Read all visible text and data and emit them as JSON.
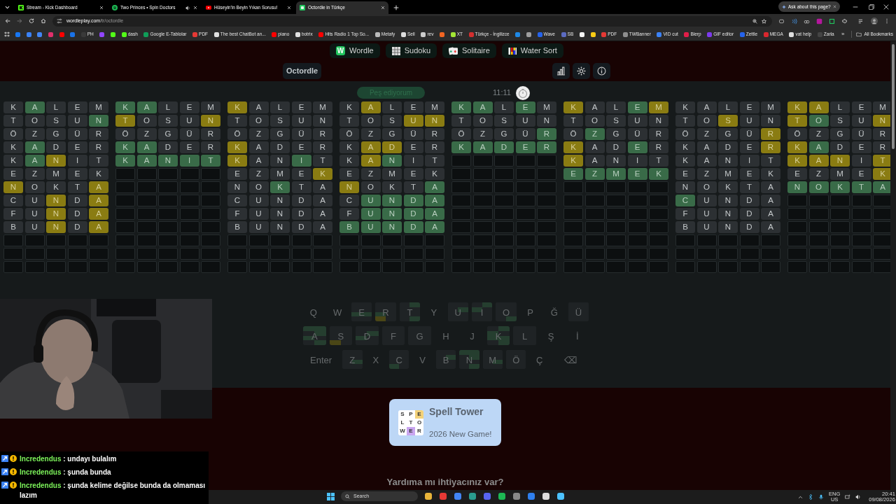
{
  "browser": {
    "tabs": [
      {
        "title": "Stream - Kick Dashboard",
        "kind": "kick",
        "audio": false,
        "selected": false
      },
      {
        "title": "Two Princes • Spin Doctors",
        "kind": "spotify",
        "audio": true,
        "selected": false
      },
      {
        "title": "Hüseyin'in Beyin Yıkan Sorusu!",
        "kind": "youtube",
        "audio": false,
        "selected": false
      },
      {
        "title": "Octordle in Türkçe",
        "kind": "wordle",
        "audio": false,
        "selected": true
      }
    ],
    "ask_button": "Ask about this page?",
    "url_host": "wordleplay.com",
    "url_path": "/tr/octordle",
    "bookmarks": [
      {
        "color": "#1877f2"
      },
      {
        "color": "#3b82f6"
      },
      {
        "color": "#4285f4"
      },
      {
        "color": "#e1306c"
      },
      {
        "color": "#ff0000"
      },
      {
        "color": "#1a73e8"
      },
      {
        "label": "PH",
        "color": "#3a3a3a"
      },
      {
        "color": "#9146ff"
      },
      {
        "color": "#53fc18"
      },
      {
        "label": "dash",
        "color": "#53fc18"
      },
      {
        "label": "Google E-Tablolar",
        "color": "#0f9d58"
      },
      {
        "label": "PDF",
        "color": "#e53935"
      },
      {
        "label": "The best ChatBot an...",
        "color": "#e0e0e0"
      },
      {
        "label": "piano",
        "color": "#ff0000"
      },
      {
        "label": "botrix",
        "color": "#e0e0e0"
      },
      {
        "label": "Hits Radio 1 Top So...",
        "color": "#ff0000"
      },
      {
        "label": "Metafy",
        "color": "#bbbbbb"
      },
      {
        "label": "Sell",
        "color": "#dddddd"
      },
      {
        "label": "rev",
        "color": "#cccccc"
      },
      {
        "color": "#f26522"
      },
      {
        "label": "XT",
        "color": "#a3e635"
      },
      {
        "label": "Türkçe - İngilizce",
        "color": "#d32f2f"
      },
      {
        "color": "#1e88e5"
      },
      {
        "color": "#9e9e9e"
      },
      {
        "label": "Wave",
        "color": "#2563eb"
      },
      {
        "label": "SB",
        "color": "#5c6bc0"
      },
      {
        "color": "#f5f5f5"
      },
      {
        "color": "#facc15"
      },
      {
        "label": "PDF",
        "color": "#e53935"
      },
      {
        "label": "TWBanner",
        "color": "#8e8e8e"
      },
      {
        "label": "VID cut",
        "color": "#3b82f6"
      },
      {
        "label": "Blerp",
        "color": "#e11d48"
      },
      {
        "label": "GIF editor",
        "color": "#7c3aed"
      },
      {
        "label": "Zettle",
        "color": "#2563eb"
      },
      {
        "label": "MEGA",
        "color": "#d9272e"
      },
      {
        "label": "vat help",
        "color": "#dddddd"
      },
      {
        "label": "Zarla",
        "color": "#444444"
      }
    ],
    "more_bookmarks": "»",
    "all_bookmarks": "All Bookmarks"
  },
  "site": {
    "nav": [
      {
        "label": "Wordle",
        "kind": "wordle",
        "icon_text": "W"
      },
      {
        "label": "Sudoku",
        "kind": "sudoku"
      },
      {
        "label": "Solitaire",
        "kind": "solitaire"
      },
      {
        "label": "Water Sort",
        "kind": "watersort"
      }
    ],
    "game_button": "Octordle",
    "give_up": "Peş ediyorum",
    "timer": "11:11",
    "boards": [
      {
        "rows": [
          {
            "tiles": [
              {
                "letter": "K",
                "kind": "absent"
              },
              {
                "letter": "A",
                "kind": "correct"
              },
              {
                "letter": "L",
                "kind": "absent"
              },
              {
                "letter": "E",
                "kind": "absent"
              },
              {
                "letter": "M",
                "kind": "absent"
              }
            ]
          },
          {
            "tiles": [
              {
                "letter": "T",
                "kind": "absent"
              },
              {
                "letter": "O",
                "kind": "absent"
              },
              {
                "letter": "S",
                "kind": "absent"
              },
              {
                "letter": "U",
                "kind": "absent"
              },
              {
                "letter": "N",
                "kind": "correct"
              }
            ]
          },
          {
            "tiles": [
              {
                "letter": "Ö",
                "kind": "absent"
              },
              {
                "letter": "Z",
                "kind": "absent"
              },
              {
                "letter": "G",
                "kind": "absent"
              },
              {
                "letter": "Ü",
                "kind": "absent"
              },
              {
                "letter": "R",
                "kind": "absent"
              }
            ]
          },
          {
            "tiles": [
              {
                "letter": "K",
                "kind": "absent"
              },
              {
                "letter": "A",
                "kind": "correct"
              },
              {
                "letter": "D",
                "kind": "absent"
              },
              {
                "letter": "E",
                "kind": "absent"
              },
              {
                "letter": "R",
                "kind": "absent"
              }
            ]
          },
          {
            "tiles": [
              {
                "letter": "K",
                "kind": "absent"
              },
              {
                "letter": "A",
                "kind": "correct"
              },
              {
                "letter": "N",
                "kind": "present"
              },
              {
                "letter": "I",
                "kind": "absent"
              },
              {
                "letter": "T",
                "kind": "absent"
              }
            ]
          },
          {
            "tiles": [
              {
                "letter": "E",
                "kind": "absent"
              },
              {
                "letter": "Z",
                "kind": "absent"
              },
              {
                "letter": "M",
                "kind": "absent"
              },
              {
                "letter": "E",
                "kind": "absent"
              },
              {
                "letter": "K",
                "kind": "absent"
              }
            ]
          },
          {
            "tiles": [
              {
                "letter": "N",
                "kind": "present"
              },
              {
                "letter": "O",
                "kind": "absent"
              },
              {
                "letter": "K",
                "kind": "absent"
              },
              {
                "letter": "T",
                "kind": "absent"
              },
              {
                "letter": "A",
                "kind": "present"
              }
            ]
          },
          {
            "tiles": [
              {
                "letter": "C",
                "kind": "absent"
              },
              {
                "letter": "U",
                "kind": "absent"
              },
              {
                "letter": "N",
                "kind": "present"
              },
              {
                "letter": "D",
                "kind": "absent"
              },
              {
                "letter": "A",
                "kind": "present"
              }
            ]
          },
          {
            "tiles": [
              {
                "letter": "F",
                "kind": "absent"
              },
              {
                "letter": "U",
                "kind": "absent"
              },
              {
                "letter": "N",
                "kind": "present"
              },
              {
                "letter": "D",
                "kind": "absent"
              },
              {
                "letter": "A",
                "kind": "present"
              }
            ]
          },
          {
            "tiles": [
              {
                "letter": "B",
                "kind": "absent"
              },
              {
                "letter": "U",
                "kind": "absent"
              },
              {
                "letter": "N",
                "kind": "present"
              },
              {
                "letter": "D",
                "kind": "absent"
              },
              {
                "letter": "A",
                "kind": "present"
              }
            ]
          }
        ]
      },
      {
        "rows": [
          {
            "tiles": [
              {
                "letter": "K",
                "kind": "correct"
              },
              {
                "letter": "A",
                "kind": "correct"
              },
              {
                "letter": "L",
                "kind": "absent"
              },
              {
                "letter": "E",
                "kind": "absent"
              },
              {
                "letter": "M",
                "kind": "absent"
              }
            ]
          },
          {
            "tiles": [
              {
                "letter": "T",
                "kind": "present"
              },
              {
                "letter": "O",
                "kind": "absent"
              },
              {
                "letter": "S",
                "kind": "absent"
              },
              {
                "letter": "U",
                "kind": "absent"
              },
              {
                "letter": "N",
                "kind": "present"
              }
            ]
          },
          {
            "tiles": [
              {
                "letter": "Ö",
                "kind": "absent"
              },
              {
                "letter": "Z",
                "kind": "absent"
              },
              {
                "letter": "G",
                "kind": "absent"
              },
              {
                "letter": "Ü",
                "kind": "absent"
              },
              {
                "letter": "R",
                "kind": "absent"
              }
            ]
          },
          {
            "tiles": [
              {
                "letter": "K",
                "kind": "correct"
              },
              {
                "letter": "A",
                "kind": "correct"
              },
              {
                "letter": "D",
                "kind": "absent"
              },
              {
                "letter": "E",
                "kind": "absent"
              },
              {
                "letter": "R",
                "kind": "absent"
              }
            ]
          },
          {
            "tiles": [
              {
                "letter": "K",
                "kind": "correct"
              },
              {
                "letter": "A",
                "kind": "correct"
              },
              {
                "letter": "N",
                "kind": "correct"
              },
              {
                "letter": "I",
                "kind": "correct"
              },
              {
                "letter": "T",
                "kind": "correct"
              }
            ]
          }
        ]
      },
      {
        "rows": [
          {
            "tiles": [
              {
                "letter": "K",
                "kind": "present"
              },
              {
                "letter": "A",
                "kind": "absent"
              },
              {
                "letter": "L",
                "kind": "absent"
              },
              {
                "letter": "E",
                "kind": "absent"
              },
              {
                "letter": "M",
                "kind": "absent"
              }
            ]
          },
          {
            "tiles": [
              {
                "letter": "T",
                "kind": "absent"
              },
              {
                "letter": "O",
                "kind": "absent"
              },
              {
                "letter": "S",
                "kind": "absent"
              },
              {
                "letter": "U",
                "kind": "absent"
              },
              {
                "letter": "N",
                "kind": "absent"
              }
            ]
          },
          {
            "tiles": [
              {
                "letter": "Ö",
                "kind": "absent"
              },
              {
                "letter": "Z",
                "kind": "absent"
              },
              {
                "letter": "G",
                "kind": "absent"
              },
              {
                "letter": "Ü",
                "kind": "absent"
              },
              {
                "letter": "R",
                "kind": "absent"
              }
            ]
          },
          {
            "tiles": [
              {
                "letter": "K",
                "kind": "present"
              },
              {
                "letter": "A",
                "kind": "absent"
              },
              {
                "letter": "D",
                "kind": "absent"
              },
              {
                "letter": "E",
                "kind": "absent"
              },
              {
                "letter": "R",
                "kind": "absent"
              }
            ]
          },
          {
            "tiles": [
              {
                "letter": "K",
                "kind": "present"
              },
              {
                "letter": "A",
                "kind": "absent"
              },
              {
                "letter": "N",
                "kind": "absent"
              },
              {
                "letter": "I",
                "kind": "correct"
              },
              {
                "letter": "T",
                "kind": "absent"
              }
            ]
          },
          {
            "tiles": [
              {
                "letter": "E",
                "kind": "absent"
              },
              {
                "letter": "Z",
                "kind": "absent"
              },
              {
                "letter": "M",
                "kind": "absent"
              },
              {
                "letter": "E",
                "kind": "absent"
              },
              {
                "letter": "K",
                "kind": "present"
              }
            ]
          },
          {
            "tiles": [
              {
                "letter": "N",
                "kind": "absent"
              },
              {
                "letter": "O",
                "kind": "absent"
              },
              {
                "letter": "K",
                "kind": "correct"
              },
              {
                "letter": "T",
                "kind": "absent"
              },
              {
                "letter": "A",
                "kind": "absent"
              }
            ]
          },
          {
            "tiles": [
              {
                "letter": "C",
                "kind": "absent"
              },
              {
                "letter": "U",
                "kind": "absent"
              },
              {
                "letter": "N",
                "kind": "absent"
              },
              {
                "letter": "D",
                "kind": "absent"
              },
              {
                "letter": "A",
                "kind": "absent"
              }
            ]
          },
          {
            "tiles": [
              {
                "letter": "F",
                "kind": "absent"
              },
              {
                "letter": "U",
                "kind": "absent"
              },
              {
                "letter": "N",
                "kind": "absent"
              },
              {
                "letter": "D",
                "kind": "absent"
              },
              {
                "letter": "A",
                "kind": "absent"
              }
            ]
          },
          {
            "tiles": [
              {
                "letter": "B",
                "kind": "absent"
              },
              {
                "letter": "U",
                "kind": "absent"
              },
              {
                "letter": "N",
                "kind": "absent"
              },
              {
                "letter": "D",
                "kind": "absent"
              },
              {
                "letter": "A",
                "kind": "absent"
              }
            ]
          }
        ]
      },
      {
        "rows": [
          {
            "tiles": [
              {
                "letter": "K",
                "kind": "absent"
              },
              {
                "letter": "A",
                "kind": "present"
              },
              {
                "letter": "L",
                "kind": "absent"
              },
              {
                "letter": "E",
                "kind": "absent"
              },
              {
                "letter": "M",
                "kind": "absent"
              }
            ]
          },
          {
            "tiles": [
              {
                "letter": "T",
                "kind": "absent"
              },
              {
                "letter": "O",
                "kind": "absent"
              },
              {
                "letter": "S",
                "kind": "absent"
              },
              {
                "letter": "U",
                "kind": "present"
              },
              {
                "letter": "N",
                "kind": "present"
              }
            ]
          },
          {
            "tiles": [
              {
                "letter": "Ö",
                "kind": "absent"
              },
              {
                "letter": "Z",
                "kind": "absent"
              },
              {
                "letter": "G",
                "kind": "absent"
              },
              {
                "letter": "Ü",
                "kind": "absent"
              },
              {
                "letter": "R",
                "kind": "absent"
              }
            ]
          },
          {
            "tiles": [
              {
                "letter": "K",
                "kind": "absent"
              },
              {
                "letter": "A",
                "kind": "present"
              },
              {
                "letter": "D",
                "kind": "present"
              },
              {
                "letter": "E",
                "kind": "absent"
              },
              {
                "letter": "R",
                "kind": "absent"
              }
            ]
          },
          {
            "tiles": [
              {
                "letter": "K",
                "kind": "absent"
              },
              {
                "letter": "A",
                "kind": "present"
              },
              {
                "letter": "N",
                "kind": "correct"
              },
              {
                "letter": "I",
                "kind": "absent"
              },
              {
                "letter": "T",
                "kind": "absent"
              }
            ]
          },
          {
            "tiles": [
              {
                "letter": "E",
                "kind": "absent"
              },
              {
                "letter": "Z",
                "kind": "absent"
              },
              {
                "letter": "M",
                "kind": "absent"
              },
              {
                "letter": "E",
                "kind": "absent"
              },
              {
                "letter": "K",
                "kind": "absent"
              }
            ]
          },
          {
            "tiles": [
              {
                "letter": "N",
                "kind": "present"
              },
              {
                "letter": "O",
                "kind": "absent"
              },
              {
                "letter": "K",
                "kind": "absent"
              },
              {
                "letter": "T",
                "kind": "absent"
              },
              {
                "letter": "A",
                "kind": "correct"
              }
            ]
          },
          {
            "tiles": [
              {
                "letter": "C",
                "kind": "absent"
              },
              {
                "letter": "U",
                "kind": "correct"
              },
              {
                "letter": "N",
                "kind": "correct"
              },
              {
                "letter": "D",
                "kind": "correct"
              },
              {
                "letter": "A",
                "kind": "correct"
              }
            ]
          },
          {
            "tiles": [
              {
                "letter": "F",
                "kind": "absent"
              },
              {
                "letter": "U",
                "kind": "correct"
              },
              {
                "letter": "N",
                "kind": "correct"
              },
              {
                "letter": "D",
                "kind": "correct"
              },
              {
                "letter": "A",
                "kind": "correct"
              }
            ]
          },
          {
            "tiles": [
              {
                "letter": "B",
                "kind": "correct"
              },
              {
                "letter": "U",
                "kind": "correct"
              },
              {
                "letter": "N",
                "kind": "correct"
              },
              {
                "letter": "D",
                "kind": "correct"
              },
              {
                "letter": "A",
                "kind": "correct"
              }
            ]
          }
        ]
      },
      {
        "rows": [
          {
            "tiles": [
              {
                "letter": "K",
                "kind": "correct"
              },
              {
                "letter": "A",
                "kind": "correct"
              },
              {
                "letter": "L",
                "kind": "absent"
              },
              {
                "letter": "E",
                "kind": "correct"
              },
              {
                "letter": "M",
                "kind": "absent"
              }
            ]
          },
          {
            "tiles": [
              {
                "letter": "T",
                "kind": "absent"
              },
              {
                "letter": "O",
                "kind": "absent"
              },
              {
                "letter": "S",
                "kind": "absent"
              },
              {
                "letter": "U",
                "kind": "absent"
              },
              {
                "letter": "N",
                "kind": "absent"
              }
            ]
          },
          {
            "tiles": [
              {
                "letter": "Ö",
                "kind": "absent"
              },
              {
                "letter": "Z",
                "kind": "absent"
              },
              {
                "letter": "G",
                "kind": "absent"
              },
              {
                "letter": "Ü",
                "kind": "absent"
              },
              {
                "letter": "R",
                "kind": "correct"
              }
            ]
          },
          {
            "tiles": [
              {
                "letter": "K",
                "kind": "correct"
              },
              {
                "letter": "A",
                "kind": "correct"
              },
              {
                "letter": "D",
                "kind": "correct"
              },
              {
                "letter": "E",
                "kind": "correct"
              },
              {
                "letter": "R",
                "kind": "correct"
              }
            ]
          }
        ]
      },
      {
        "rows": [
          {
            "tiles": [
              {
                "letter": "K",
                "kind": "present"
              },
              {
                "letter": "A",
                "kind": "absent"
              },
              {
                "letter": "L",
                "kind": "absent"
              },
              {
                "letter": "E",
                "kind": "correct"
              },
              {
                "letter": "M",
                "kind": "present"
              }
            ]
          },
          {
            "tiles": [
              {
                "letter": "T",
                "kind": "absent"
              },
              {
                "letter": "O",
                "kind": "absent"
              },
              {
                "letter": "S",
                "kind": "absent"
              },
              {
                "letter": "U",
                "kind": "absent"
              },
              {
                "letter": "N",
                "kind": "absent"
              }
            ]
          },
          {
            "tiles": [
              {
                "letter": "Ö",
                "kind": "absent"
              },
              {
                "letter": "Z",
                "kind": "correct"
              },
              {
                "letter": "G",
                "kind": "absent"
              },
              {
                "letter": "Ü",
                "kind": "absent"
              },
              {
                "letter": "R",
                "kind": "absent"
              }
            ]
          },
          {
            "tiles": [
              {
                "letter": "K",
                "kind": "present"
              },
              {
                "letter": "A",
                "kind": "absent"
              },
              {
                "letter": "D",
                "kind": "absent"
              },
              {
                "letter": "E",
                "kind": "correct"
              },
              {
                "letter": "R",
                "kind": "absent"
              }
            ]
          },
          {
            "tiles": [
              {
                "letter": "K",
                "kind": "present"
              },
              {
                "letter": "A",
                "kind": "absent"
              },
              {
                "letter": "N",
                "kind": "absent"
              },
              {
                "letter": "I",
                "kind": "absent"
              },
              {
                "letter": "T",
                "kind": "absent"
              }
            ]
          },
          {
            "tiles": [
              {
                "letter": "E",
                "kind": "correct"
              },
              {
                "letter": "Z",
                "kind": "correct"
              },
              {
                "letter": "M",
                "kind": "correct"
              },
              {
                "letter": "E",
                "kind": "correct"
              },
              {
                "letter": "K",
                "kind": "correct"
              }
            ]
          }
        ]
      },
      {
        "rows": [
          {
            "tiles": [
              {
                "letter": "K",
                "kind": "absent"
              },
              {
                "letter": "A",
                "kind": "absent"
              },
              {
                "letter": "L",
                "kind": "absent"
              },
              {
                "letter": "E",
                "kind": "absent"
              },
              {
                "letter": "M",
                "kind": "absent"
              }
            ]
          },
          {
            "tiles": [
              {
                "letter": "T",
                "kind": "absent"
              },
              {
                "letter": "O",
                "kind": "absent"
              },
              {
                "letter": "S",
                "kind": "present"
              },
              {
                "letter": "U",
                "kind": "absent"
              },
              {
                "letter": "N",
                "kind": "absent"
              }
            ]
          },
          {
            "tiles": [
              {
                "letter": "Ö",
                "kind": "absent"
              },
              {
                "letter": "Z",
                "kind": "absent"
              },
              {
                "letter": "G",
                "kind": "absent"
              },
              {
                "letter": "Ü",
                "kind": "absent"
              },
              {
                "letter": "R",
                "kind": "present"
              }
            ]
          },
          {
            "tiles": [
              {
                "letter": "K",
                "kind": "absent"
              },
              {
                "letter": "A",
                "kind": "absent"
              },
              {
                "letter": "D",
                "kind": "absent"
              },
              {
                "letter": "E",
                "kind": "absent"
              },
              {
                "letter": "R",
                "kind": "present"
              }
            ]
          },
          {
            "tiles": [
              {
                "letter": "K",
                "kind": "absent"
              },
              {
                "letter": "A",
                "kind": "absent"
              },
              {
                "letter": "N",
                "kind": "absent"
              },
              {
                "letter": "I",
                "kind": "absent"
              },
              {
                "letter": "T",
                "kind": "absent"
              }
            ]
          },
          {
            "tiles": [
              {
                "letter": "E",
                "kind": "absent"
              },
              {
                "letter": "Z",
                "kind": "absent"
              },
              {
                "letter": "M",
                "kind": "absent"
              },
              {
                "letter": "E",
                "kind": "absent"
              },
              {
                "letter": "K",
                "kind": "absent"
              }
            ]
          },
          {
            "tiles": [
              {
                "letter": "N",
                "kind": "absent"
              },
              {
                "letter": "O",
                "kind": "absent"
              },
              {
                "letter": "K",
                "kind": "absent"
              },
              {
                "letter": "T",
                "kind": "absent"
              },
              {
                "letter": "A",
                "kind": "absent"
              }
            ]
          },
          {
            "tiles": [
              {
                "letter": "C",
                "kind": "correct"
              },
              {
                "letter": "U",
                "kind": "absent"
              },
              {
                "letter": "N",
                "kind": "absent"
              },
              {
                "letter": "D",
                "kind": "absent"
              },
              {
                "letter": "A",
                "kind": "absent"
              }
            ]
          },
          {
            "tiles": [
              {
                "letter": "F",
                "kind": "absent"
              },
              {
                "letter": "U",
                "kind": "absent"
              },
              {
                "letter": "N",
                "kind": "absent"
              },
              {
                "letter": "D",
                "kind": "absent"
              },
              {
                "letter": "A",
                "kind": "absent"
              }
            ]
          },
          {
            "tiles": [
              {
                "letter": "B",
                "kind": "absent"
              },
              {
                "letter": "U",
                "kind": "absent"
              },
              {
                "letter": "N",
                "kind": "absent"
              },
              {
                "letter": "D",
                "kind": "absent"
              },
              {
                "letter": "A",
                "kind": "absent"
              }
            ]
          }
        ]
      },
      {
        "rows": [
          {
            "tiles": [
              {
                "letter": "K",
                "kind": "present"
              },
              {
                "letter": "A",
                "kind": "present"
              },
              {
                "letter": "L",
                "kind": "absent"
              },
              {
                "letter": "E",
                "kind": "absent"
              },
              {
                "letter": "M",
                "kind": "absent"
              }
            ]
          },
          {
            "tiles": [
              {
                "letter": "T",
                "kind": "present"
              },
              {
                "letter": "O",
                "kind": "correct"
              },
              {
                "letter": "S",
                "kind": "absent"
              },
              {
                "letter": "U",
                "kind": "absent"
              },
              {
                "letter": "N",
                "kind": "present"
              }
            ]
          },
          {
            "tiles": [
              {
                "letter": "Ö",
                "kind": "absent"
              },
              {
                "letter": "Z",
                "kind": "absent"
              },
              {
                "letter": "G",
                "kind": "absent"
              },
              {
                "letter": "Ü",
                "kind": "absent"
              },
              {
                "letter": "R",
                "kind": "absent"
              }
            ]
          },
          {
            "tiles": [
              {
                "letter": "K",
                "kind": "present"
              },
              {
                "letter": "A",
                "kind": "correct"
              },
              {
                "letter": "D",
                "kind": "absent"
              },
              {
                "letter": "E",
                "kind": "absent"
              },
              {
                "letter": "R",
                "kind": "absent"
              }
            ]
          },
          {
            "tiles": [
              {
                "letter": "K",
                "kind": "present"
              },
              {
                "letter": "A",
                "kind": "present"
              },
              {
                "letter": "N",
                "kind": "present"
              },
              {
                "letter": "I",
                "kind": "absent"
              },
              {
                "letter": "T",
                "kind": "present"
              }
            ]
          },
          {
            "tiles": [
              {
                "letter": "E",
                "kind": "absent"
              },
              {
                "letter": "Z",
                "kind": "absent"
              },
              {
                "letter": "M",
                "kind": "absent"
              },
              {
                "letter": "E",
                "kind": "absent"
              },
              {
                "letter": "K",
                "kind": "present"
              }
            ]
          },
          {
            "tiles": [
              {
                "letter": "N",
                "kind": "correct"
              },
              {
                "letter": "O",
                "kind": "correct"
              },
              {
                "letter": "K",
                "kind": "correct"
              },
              {
                "letter": "T",
                "kind": "correct"
              },
              {
                "letter": "A",
                "kind": "correct"
              }
            ]
          }
        ]
      }
    ],
    "keyboard": [
      [
        "Q",
        "W",
        "E",
        "R",
        "T",
        "Y",
        "U",
        "I",
        "O",
        "P",
        "Ğ",
        "Ü"
      ],
      [
        "A",
        "S",
        "D",
        "F",
        "G",
        "H",
        "J",
        "K",
        "L",
        "Ş",
        "İ"
      ],
      [
        "Enter",
        "Z",
        "X",
        "C",
        "V",
        "B",
        "N",
        "M",
        "Ö",
        "Ç",
        "⌫"
      ]
    ],
    "promo": {
      "title": "Spell Tower",
      "subtitle": "2026 New Game!",
      "icon_letters": [
        "S",
        "P",
        "E",
        "L",
        "T",
        "O",
        "W",
        "E",
        "R"
      ]
    },
    "help_heading": "Yardıma mı ihtiyacınız var?"
  },
  "stream_overlay": {
    "chat": [
      {
        "user": "Incredendus",
        "text": ": undayı bulalım"
      },
      {
        "user": "Incredendus",
        "text": ": şunda bunda"
      },
      {
        "user": "Incredendus",
        "text": ": şunda kelime değilse bunda da olmaması lazım"
      }
    ]
  },
  "taskbar": {
    "search": "Search",
    "language": "ENG",
    "region": "US",
    "time": "20:41",
    "date": "09/08/2026"
  }
}
